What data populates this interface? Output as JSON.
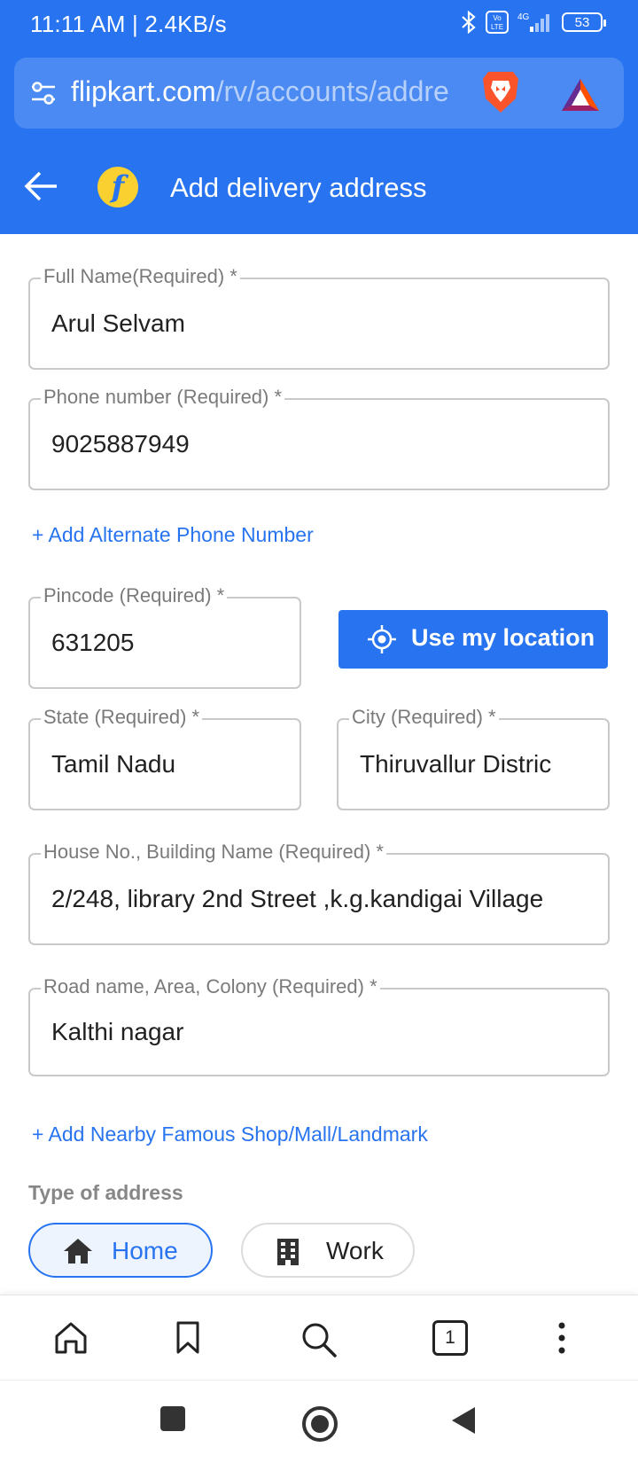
{
  "status_bar": {
    "text": "11:11 AM | 2.4KB/s",
    "network": "4G",
    "volte": "Vo LTE",
    "battery": "53"
  },
  "url_bar": {
    "domain": "flipkart.com",
    "path": "/rv/accounts/addre"
  },
  "header": {
    "title": "Add delivery address",
    "logo_letter": "f"
  },
  "form": {
    "full_name": {
      "label": "Full Name(Required) *",
      "value": "Arul Selvam"
    },
    "phone": {
      "label": "Phone number (Required) *",
      "value": "9025887949"
    },
    "alt_phone_link": "+ Add Alternate Phone Number",
    "pincode": {
      "label": "Pincode (Required) *",
      "value": "631205"
    },
    "use_location_label": "Use my location",
    "state": {
      "label": "State (Required) *",
      "value": "Tamil Nadu"
    },
    "city": {
      "label": "City (Required) *",
      "value": "Thiruvallur Distric"
    },
    "house": {
      "label": "House No., Building Name (Required) *",
      "value": "2/248, library 2nd Street ,k.g.kandigai Village"
    },
    "road": {
      "label": "Road name, Area, Colony (Required) *",
      "value": "Kalthi nagar"
    },
    "landmark_link": "+ Add Nearby Famous Shop/Mall/Landmark",
    "address_type": {
      "heading": "Type of address",
      "home_label": "Home",
      "work_label": "Work"
    }
  },
  "browser_bar": {
    "tab_count": "1"
  },
  "colors": {
    "primary": "#2874f0",
    "logo_yellow": "#f9d030"
  }
}
